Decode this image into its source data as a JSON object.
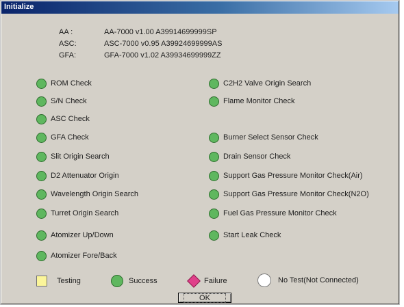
{
  "window": {
    "title": "Initialize"
  },
  "versions": [
    {
      "key": "AA :",
      "value": "AA-7000 v1.00 A39914699999SP"
    },
    {
      "key": "ASC:",
      "value": "ASC-7000 v0.95 A39924699999AS"
    },
    {
      "key": "GFA:",
      "value": "GFA-7000 v1.02 A39934699999ZZ"
    }
  ],
  "checks_left": [
    {
      "label": "ROM Check",
      "status": "success"
    },
    {
      "label": "S/N Check",
      "status": "success"
    },
    {
      "label": "ASC Check",
      "status": "success"
    },
    {
      "label": "GFA Check",
      "status": "success"
    },
    {
      "label": "Slit Origin Search",
      "status": "success"
    },
    {
      "label": "D2 Attenuator Origin",
      "status": "success"
    },
    {
      "label": "Wavelength Origin Search",
      "status": "success"
    },
    {
      "label": "Turret Origin Search",
      "status": "success"
    },
    {
      "label": "Atomizer Up/Down",
      "status": "success"
    },
    {
      "label": "Atomizer Fore/Back",
      "status": "success"
    }
  ],
  "checks_right": [
    {
      "label": "C2H2 Valve Origin Search",
      "status": "success"
    },
    {
      "label": "Flame Monitor Check",
      "status": "success"
    },
    {
      "label": "Burner Select Sensor Check",
      "status": "success"
    },
    {
      "label": "Drain Sensor Check",
      "status": "success"
    },
    {
      "label": "Support Gas Pressure Monitor Check(Air)",
      "status": "success"
    },
    {
      "label": "Support Gas Pressure Monitor Check(N2O)",
      "status": "success"
    },
    {
      "label": "Fuel Gas Pressure Monitor Check",
      "status": "success"
    },
    {
      "label": "Start Leak Check",
      "status": "success"
    }
  ],
  "legend": {
    "testing": "Testing",
    "success": "Success",
    "failure": "Failure",
    "no_test": "No Test(Not Connected)"
  },
  "colors": {
    "testing": "#fbf59a",
    "success": "#5fb75f",
    "failure": "#e0408a",
    "no_test": "#ffffff"
  },
  "ok_label": "OK"
}
